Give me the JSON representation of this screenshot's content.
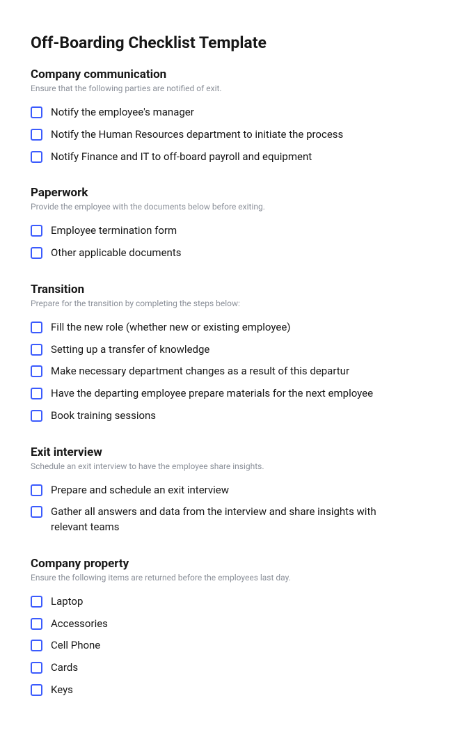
{
  "title": "Off-Boarding Checklist Template",
  "sections": [
    {
      "title": "Company communication",
      "desc": "Ensure that the following parties are notified of exit.",
      "items": [
        "Notify the employee's manager",
        "Notify the Human Resources department to initiate the process",
        "Notify Finance and IT to off-board payroll and equipment"
      ]
    },
    {
      "title": "Paperwork",
      "desc": "Provide the employee with the documents below before exiting.",
      "items": [
        "Employee termination form",
        "Other applicable documents"
      ]
    },
    {
      "title": "Transition",
      "desc": "Prepare for the transition by completing the steps below:",
      "items": [
        "Fill the new role (whether new or existing employee)",
        "Setting up a transfer of knowledge",
        "Make necessary department changes as a result of this departur",
        "Have the departing employee prepare materials for the next employee",
        "Book training sessions"
      ]
    },
    {
      "title": "Exit interview",
      "desc": "Schedule an exit interview to have the employee share insights.",
      "items": [
        "Prepare and schedule an exit interview",
        "Gather all answers and data from the interview and share insights with relevant teams"
      ]
    },
    {
      "title": "Company property",
      "desc": "Ensure the following items are returned before the employees last day.",
      "items": [
        "Laptop",
        "Accessories",
        "Cell Phone",
        "Cards",
        "Keys"
      ]
    }
  ]
}
